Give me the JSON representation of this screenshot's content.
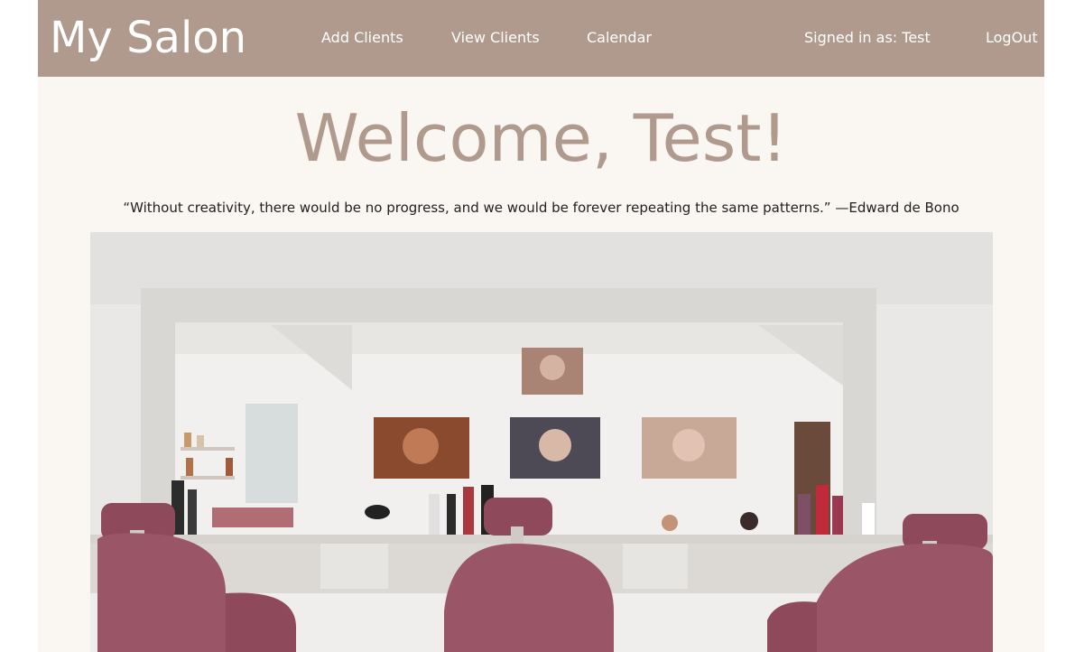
{
  "nav": {
    "brand": "My Salon",
    "links": [
      "Add Clients",
      "View Clients",
      "Calendar"
    ],
    "signed_in": "Signed in as: Test",
    "logout": "LogOut"
  },
  "main": {
    "welcome": "Welcome, Test!",
    "quote": "“Without creativity, there would be no progress, and we would be forever repeating the same patterns.” —Edward de Bono"
  },
  "colors": {
    "nav_bg": "#b09a8d",
    "page_bg": "#faf6f2",
    "accent_text": "#b09a8d",
    "chair": "#8e4a5a"
  }
}
